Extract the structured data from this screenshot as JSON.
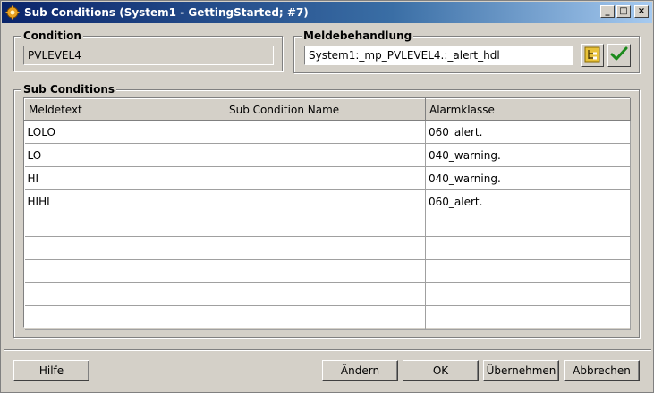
{
  "window": {
    "title": "Sub Conditions (System1 - GettingStarted; #7)",
    "minimize": "_",
    "maximize": "□",
    "close": "×"
  },
  "condition": {
    "legend": "Condition",
    "value": "PVLEVEL4"
  },
  "meldebehandlung": {
    "legend": "Meldebehandlung",
    "value": "System1:_mp_PVLEVEL4.:_alert_hdl"
  },
  "sub_conditions": {
    "legend": "Sub Conditions",
    "columns": [
      "Meldetext",
      "Sub Condition Name",
      "Alarmklasse"
    ],
    "rows": [
      [
        "LOLO",
        "",
        "060_alert."
      ],
      [
        "LO",
        "",
        "040_warning."
      ],
      [
        "HI",
        "",
        "040_warning."
      ],
      [
        "HIHI",
        "",
        "060_alert."
      ],
      [
        "",
        "",
        ""
      ],
      [
        "",
        "",
        ""
      ],
      [
        "",
        "",
        ""
      ],
      [
        "",
        "",
        ""
      ],
      [
        "",
        "",
        ""
      ]
    ]
  },
  "buttons": {
    "help": "Hilfe",
    "change": "Ändern",
    "ok": "OK",
    "apply": "Übernehmen",
    "cancel": "Abbrechen"
  },
  "colors": {
    "titlebar_start": "#0a246a",
    "titlebar_end": "#a6caf0",
    "face": "#d4d0c8",
    "check_green": "#1c8a1c",
    "tree_icon": "#e8c23a"
  }
}
